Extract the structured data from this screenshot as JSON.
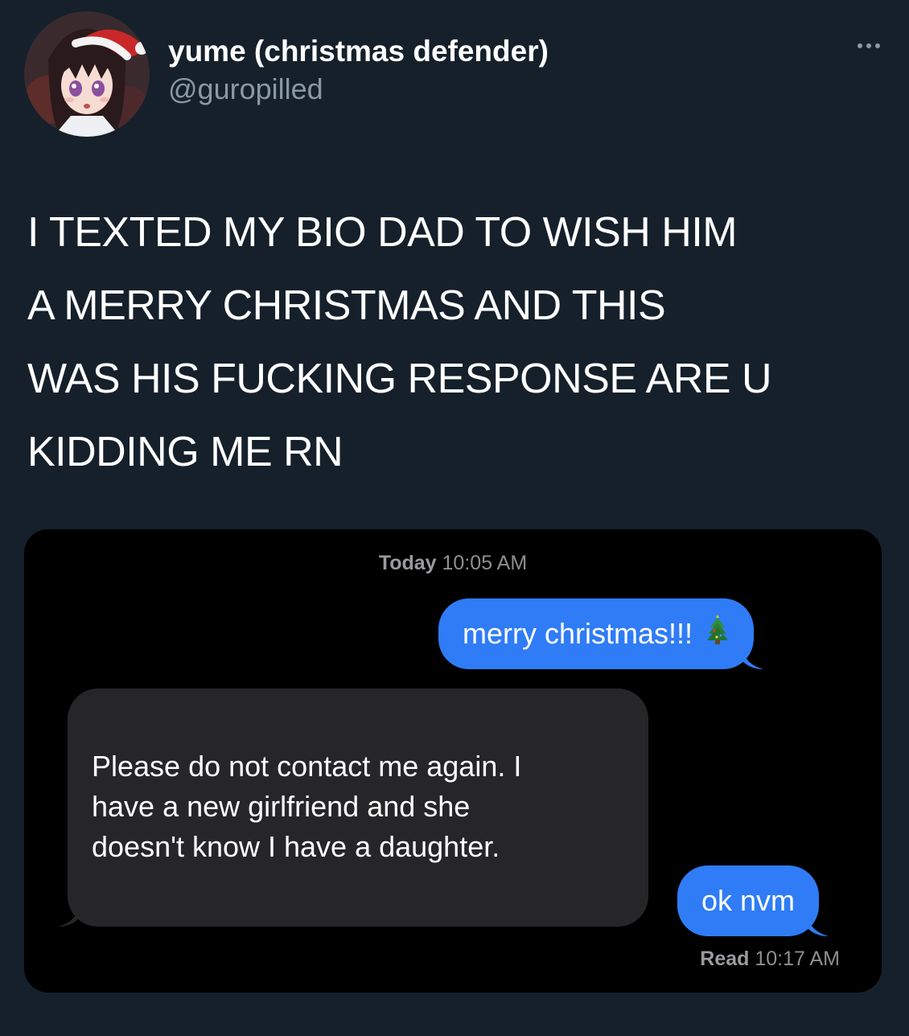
{
  "tweet": {
    "author": {
      "display_name": "yume (christmas defender)",
      "handle": "@guropilled",
      "avatar": "anime-girl-santa-hat-avatar"
    },
    "more_icon": "more-horizontal-icon",
    "text": "I TEXTED MY BIO DAD TO WISH HIM\nA MERRY CHRISTMAS AND THIS\nWAS HIS FUCKING RESPONSE ARE U\nKIDDING ME RN"
  },
  "conversation": {
    "timestamp_day": "Today",
    "timestamp_time": "10:05 AM",
    "messages": [
      {
        "from": "me",
        "text": "merry christmas!!!",
        "emoji": "🎄"
      },
      {
        "from": "them",
        "text": "Please do not contact me again. I\nhave a new girlfriend and she\ndoesn't know I have a daughter."
      },
      {
        "from": "me",
        "text": "ok nvm"
      }
    ],
    "read_label": "Read",
    "read_time": "10:17 AM"
  },
  "colors": {
    "background": "#15202b",
    "sent_bubble": "#2f7cf6",
    "received_bubble": "#262628",
    "secondary_text": "#8b98a5"
  }
}
